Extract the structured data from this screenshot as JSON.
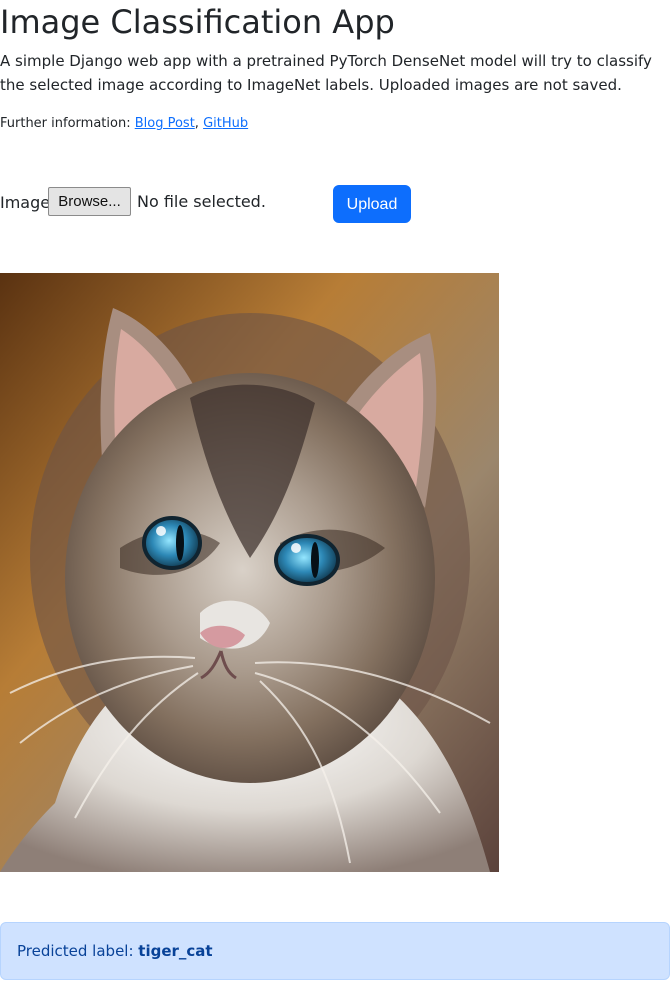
{
  "header": {
    "title": "Image Classification App",
    "description": "A simple Django web app with a pretrained PyTorch DenseNet model will try to classify the selected image according to ImageNet labels. Uploaded images are not saved."
  },
  "further_info": {
    "label": "Further information:",
    "links": [
      {
        "label": "Blog Post"
      },
      {
        "label": "GitHub"
      }
    ]
  },
  "upload_form": {
    "field_label": "Image:",
    "browse_label": "Browse...",
    "file_status": "No file selected.",
    "upload_label": "Upload"
  },
  "preview": {
    "subject": "cat-photo"
  },
  "prediction": {
    "label": "Predicted label:",
    "value": "tiger_cat"
  },
  "colors": {
    "primary": "#0d6efd",
    "alert_background": "#cfe2ff",
    "alert_text": "#084298",
    "browse_button": "#e4e4e4"
  }
}
